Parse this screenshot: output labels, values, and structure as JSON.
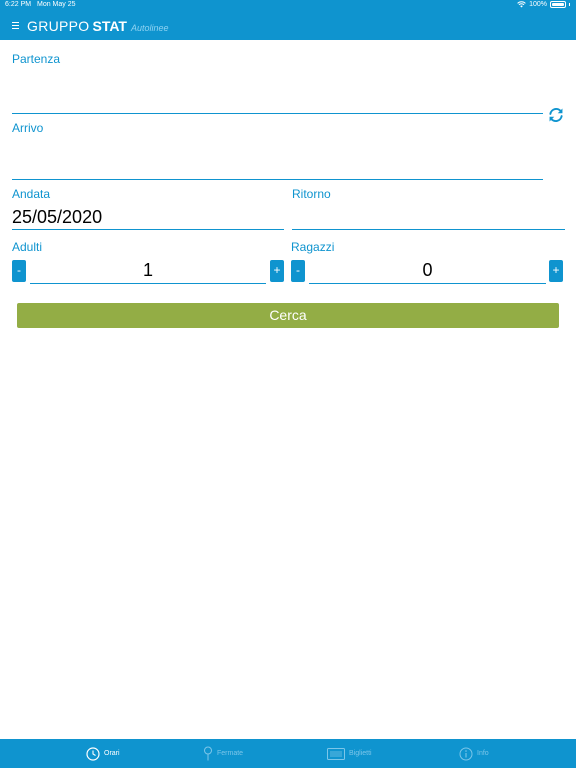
{
  "status_bar": {
    "time": "6:22 PM",
    "date": "Mon May 25",
    "battery": "100%"
  },
  "header": {
    "brand_primary": "GRUPPO",
    "brand_bold": "STAT",
    "brand_sub": "Autolinee"
  },
  "form": {
    "departure": {
      "label": "Partenza",
      "value": ""
    },
    "arrival": {
      "label": "Arrivo",
      "value": ""
    },
    "outbound": {
      "label": "Andata",
      "value": "25/05/2020"
    },
    "return": {
      "label": "Ritorno",
      "value": ""
    },
    "adults": {
      "label": "Adulti",
      "value": "1",
      "minus": "-",
      "plus": "+"
    },
    "children": {
      "label": "Ragazzi",
      "value": "0",
      "minus": "-",
      "plus": "+"
    },
    "search_label": "Cerca"
  },
  "tabs": [
    {
      "label": "Orari",
      "icon": "clock-icon",
      "active": true
    },
    {
      "label": "Fermate",
      "icon": "pin-icon",
      "active": false
    },
    {
      "label": "Biglietti",
      "icon": "ticket-icon",
      "active": false
    },
    {
      "label": "Info",
      "icon": "info-icon",
      "active": false
    }
  ],
  "colors": {
    "primary": "#0f94cf",
    "search_button": "#93ad45",
    "inactive_tab": "#7cc6e9"
  }
}
